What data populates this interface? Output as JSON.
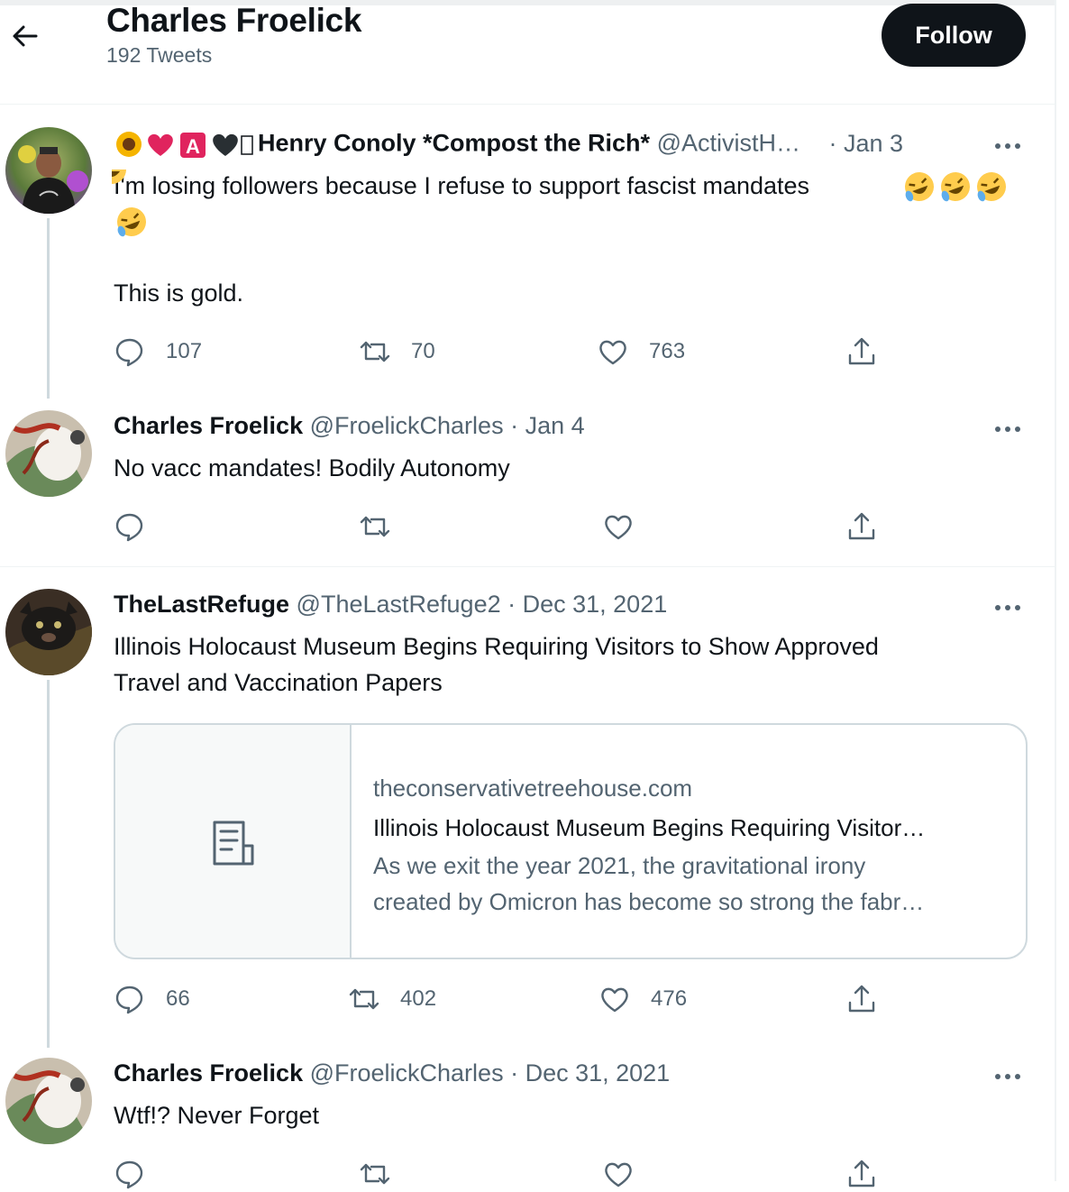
{
  "header": {
    "name": "Charles Froelick",
    "tweet_count": "192 Tweets",
    "follow_label": "Follow"
  },
  "tweets": [
    {
      "name": "Henry Conoly *Compost the Rich*",
      "name_emoji_prefix": "🌻❤️🅰️🖤",
      "handle": "@ActivistH…",
      "date": "· Jan 3",
      "text_line1": "I'm losing followers because I refuse to support fascist mandates",
      "emoji_line": "🤣🤣🤣🤣",
      "text_line2": "This is gold.",
      "replies": "107",
      "retweets": "70",
      "likes": "763"
    },
    {
      "name": "Charles Froelick",
      "handle": "@FroelickCharles",
      "date": "· Jan 4",
      "text": "No vacc mandates!  Bodily Autonomy",
      "replies": "",
      "retweets": "",
      "likes": ""
    },
    {
      "name": "TheLastRefuge",
      "handle": "@TheLastRefuge2",
      "date": "· Dec 31, 2021",
      "text_line1": "Illinois Holocaust Museum Begins Requiring Visitors to Show Approved",
      "text_line2": "Travel and Vaccination Papers",
      "card": {
        "domain": "theconservativetreehouse.com",
        "title": "Illinois Holocaust Museum Begins Requiring Visitor…",
        "desc_line1": "As we exit the year 2021, the gravitational irony",
        "desc_line2": "created by Omicron has become so strong the fabr…"
      },
      "replies": "66",
      "retweets": "402",
      "likes": "476"
    },
    {
      "name": "Charles Froelick",
      "handle": "@FroelickCharles",
      "date": "· Dec 31, 2021",
      "text": "Wtf!? Never Forget"
    }
  ],
  "colors": {
    "text": "#0f1419",
    "secondary": "#536471",
    "border": "#cfd9de",
    "follow_bg": "#0f1419"
  },
  "icons": [
    "back-arrow-icon",
    "more-icon",
    "reply-icon",
    "retweet-icon",
    "like-icon",
    "share-icon",
    "document-icon"
  ]
}
